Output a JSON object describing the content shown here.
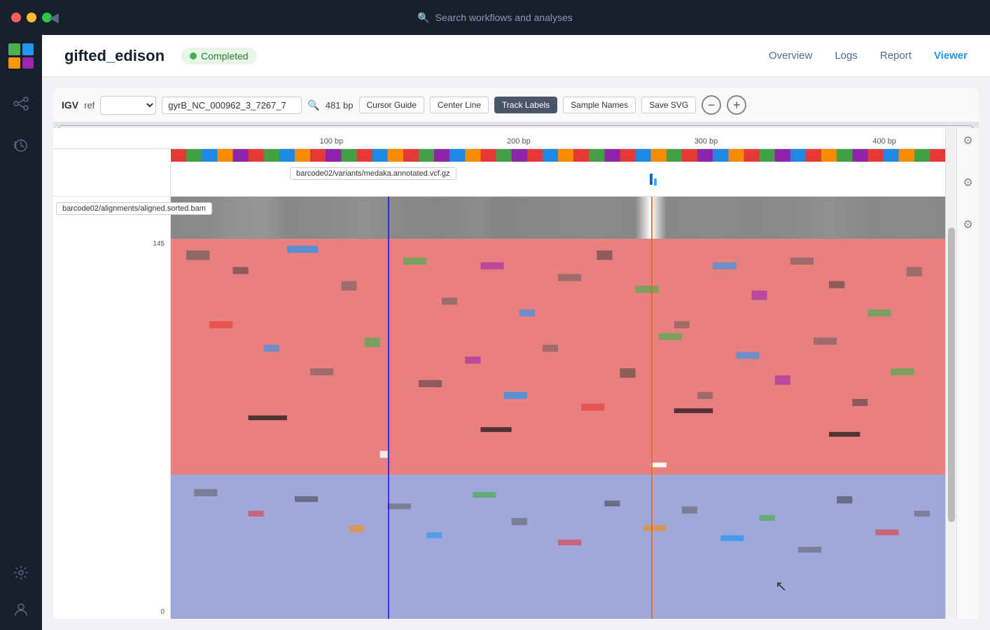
{
  "titlebar": {
    "search_placeholder": "Search workflows and analyses",
    "back_icon": "◀"
  },
  "sidebar": {
    "logo_label": "app-logo",
    "items": [
      {
        "id": "workflows",
        "icon": "⑂",
        "label": "Workflows"
      },
      {
        "id": "history",
        "icon": "↺",
        "label": "History"
      }
    ],
    "bottom_items": [
      {
        "id": "settings",
        "icon": "⚙",
        "label": "Settings"
      },
      {
        "id": "user",
        "icon": "●",
        "label": "User"
      }
    ]
  },
  "header": {
    "title": "gifted_edison",
    "status": "Completed",
    "nav": [
      {
        "id": "overview",
        "label": "Overview",
        "active": false
      },
      {
        "id": "logs",
        "label": "Logs",
        "active": false
      },
      {
        "id": "report",
        "label": "Report",
        "active": false
      },
      {
        "id": "viewer",
        "label": "Viewer",
        "active": true
      }
    ]
  },
  "igv": {
    "label": "IGV",
    "ref_label": "ref",
    "dropdown_placeholder": "",
    "search_value": "gyrB_NC_000962_3_7267_7",
    "bp_display": "481 bp",
    "buttons": [
      {
        "id": "cursor-guide",
        "label": "Cursor Guide",
        "active": false
      },
      {
        "id": "center-line",
        "label": "Center Line",
        "active": false
      },
      {
        "id": "track-labels",
        "label": "Track Labels",
        "active": true
      },
      {
        "id": "sample-names",
        "label": "Sample Names",
        "active": false
      },
      {
        "id": "save-svg",
        "label": "Save SVG",
        "active": false
      }
    ],
    "zoom_minus": "−",
    "zoom_plus": "+",
    "ruler": {
      "markers": [
        {
          "label": "100 bp",
          "pct": 18
        },
        {
          "label": "200 bp",
          "pct": 39
        },
        {
          "label": "300 bp",
          "pct": 60
        },
        {
          "label": "400 bp",
          "pct": 80
        }
      ]
    },
    "vcf_track": {
      "label": "barcode02/variants/medaka.annotated.vcf.gz",
      "markers": [
        {
          "pct": 62,
          "type": "main"
        },
        {
          "pct": 62.5,
          "type": "small"
        }
      ]
    },
    "bam_track": {
      "label": "barcode02/alignments/aligned.sorted.bam",
      "y_max": "145",
      "y_min": "0"
    },
    "cursor_lines": [
      {
        "pct": 28,
        "color": "blue"
      },
      {
        "pct": 62,
        "color": "orange"
      }
    ]
  }
}
